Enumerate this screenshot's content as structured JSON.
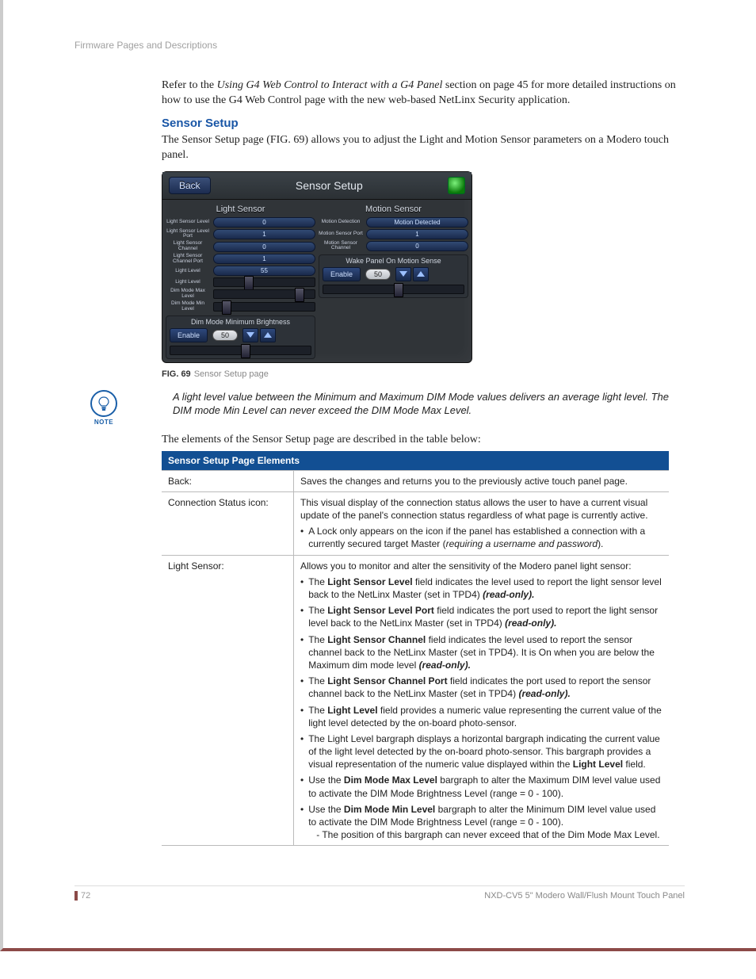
{
  "header": "Firmware Pages and Descriptions",
  "intro_before_italic": "Refer to the ",
  "intro_italic": "Using G4 Web Control to Interact with a G4 Panel",
  "intro_after_italic": " section on page 45 for more detailed instructions on how to use the G4 Web Control page with the new web-based NetLinx Security application.",
  "section_title": "Sensor Setup",
  "section_body": "The Sensor Setup page (FIG. 69) allows you to adjust the Light and Motion Sensor parameters on a Modero touch panel.",
  "panel": {
    "back": "Back",
    "title": "Sensor Setup",
    "light_title": "Light Sensor",
    "motion_title": "Motion Sensor",
    "light_rows": [
      {
        "label": "Light Sensor Level",
        "value": "0"
      },
      {
        "label": "Light Sensor Level Port",
        "value": "1"
      },
      {
        "label": "Light Sensor Channel",
        "value": "0"
      },
      {
        "label": "Light Sensor Channel Port",
        "value": "1"
      },
      {
        "label": "Light Level",
        "value": "55"
      }
    ],
    "light_bars": [
      {
        "label": "Light Level"
      },
      {
        "label": "Dim Mode Max Level"
      },
      {
        "label": "Dim Mode Min Level"
      }
    ],
    "dim_title": "Dim Mode Minimum Brightness",
    "dim_enable": "Enable",
    "dim_value": "50",
    "motion_rows": [
      {
        "label": "Motion Detection",
        "value": "Motion Detected"
      },
      {
        "label": "Motion Sensor Port",
        "value": "1"
      },
      {
        "label": "Motion Sensor Channel",
        "value": "0"
      }
    ],
    "wake_title": "Wake Panel On Motion Sense",
    "wake_enable": "Enable",
    "wake_value": "50"
  },
  "fig_num": "FIG. 69",
  "fig_label": "Sensor Setup page",
  "note_label": "NOTE",
  "note_text": "A light level value between the Minimum and Maximum DIM Mode values delivers an average light level. The DIM mode Min Level can never exceed the DIM Mode Max Level.",
  "table_lead": "The elements of the Sensor Setup page are described in the table below:",
  "table_title": "Sensor Setup Page Elements",
  "rows": {
    "back": {
      "label": "Back:",
      "desc": "Saves the changes and returns you to the previously active touch panel page."
    },
    "conn": {
      "label": "Connection Status icon:",
      "desc": "This visual display of the connection status allows the user to have a current visual update of the panel's connection status regardless of what page is currently active.",
      "b1a": "A Lock only appears on the icon if the panel has established a connection with a currently secured target Master (",
      "b1b": "requiring a username and password",
      "b1c": ")."
    },
    "light": {
      "label": "Light Sensor:",
      "desc": "Allows you to monitor and alter the sensitivity of the Modero panel light sensor:",
      "b1": {
        "pre": "The ",
        "bold": "Light Sensor Level",
        "mid": " field indicates the level used to report the light sensor level back to the NetLinx Master (set in TPD4) ",
        "ro": "(read-only)."
      },
      "b2": {
        "pre": "The ",
        "bold": "Light Sensor Level Port",
        "mid": " field indicates the port used to report the light sensor level back to the NetLinx Master (set in TPD4) ",
        "ro": "(read-only)."
      },
      "b3": {
        "pre": "The ",
        "bold": "Light Sensor Channel",
        "mid": " field indicates the level used to report the sensor channel back to the NetLinx Master (set in TPD4). It is On when you are below the Maximum dim mode level ",
        "ro": "(read-only)."
      },
      "b4": {
        "pre": "The ",
        "bold": "Light Sensor Channel Port",
        "mid": " field indicates the port used to report the sensor channel back to the NetLinx Master (set in TPD4) ",
        "ro": "(read-only)."
      },
      "b5": {
        "pre": "The ",
        "bold": "Light Level",
        "mid": " field provides a numeric value representing the current value of the light level detected by the on-board photo-sensor."
      },
      "b6": {
        "pre": "The Light Level bargraph displays a horizontal bargraph indicating the current value of the light level detected by the on-board photo-sensor. This bargraph provides a visual representation of the numeric value displayed within the ",
        "bold": "Light Level",
        "mid2": " field."
      },
      "b7": {
        "pre": "Use the ",
        "bold": "Dim Mode Max Level",
        "mid": " bargraph to alter the Maximum DIM level value used to activate the DIM Mode Brightness Level (range = 0 - 100)."
      },
      "b8": {
        "pre": "Use the ",
        "bold": "Dim Mode Min Level",
        "mid": " bargraph to alter the Minimum DIM level value used to activate the DIM Mode Brightness Level (range = 0 - 100).",
        "sub": "- The position of this bargraph can never exceed that of the Dim Mode Max Level."
      }
    }
  },
  "footer_page": "72",
  "footer_model": "NXD-CV5 5\" Modero Wall/Flush Mount Touch Panel"
}
